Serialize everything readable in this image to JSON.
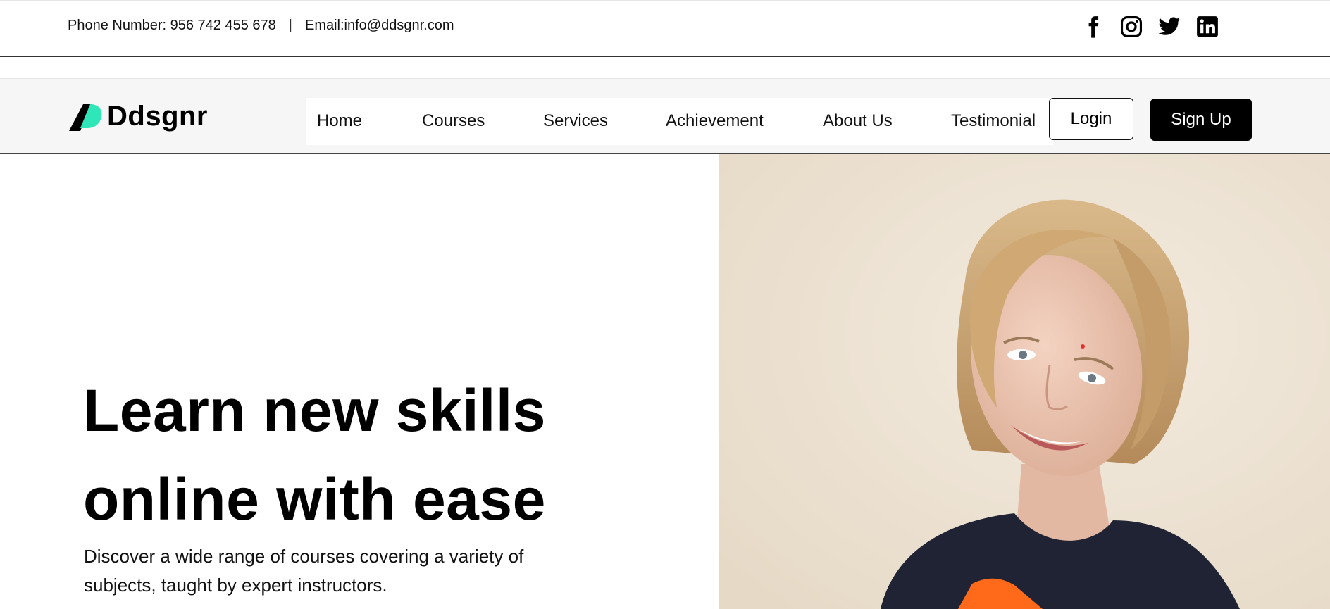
{
  "topbar": {
    "phone": "Phone Number: 956 742 455 678",
    "separator": "|",
    "email": "Email:info@ddsgnr.com",
    "socials": [
      {
        "icon": "facebook-icon"
      },
      {
        "icon": "instagram-icon"
      },
      {
        "icon": "twitter-icon"
      },
      {
        "icon": "linkedin-icon"
      }
    ]
  },
  "brand": {
    "name": "Ddsgnr",
    "accent_color": "#2ee6b8"
  },
  "nav": {
    "items": [
      "Home",
      "Courses",
      "Services",
      "Achievement",
      "About Us",
      "Testimonial"
    ],
    "login_label": "Login",
    "signup_label": "Sign Up"
  },
  "hero": {
    "title_line1": "Learn new skills",
    "title_line2": "online with ease",
    "subtitle": "Discover a wide range of courses covering a variety of subjects, taught by expert instructors."
  }
}
